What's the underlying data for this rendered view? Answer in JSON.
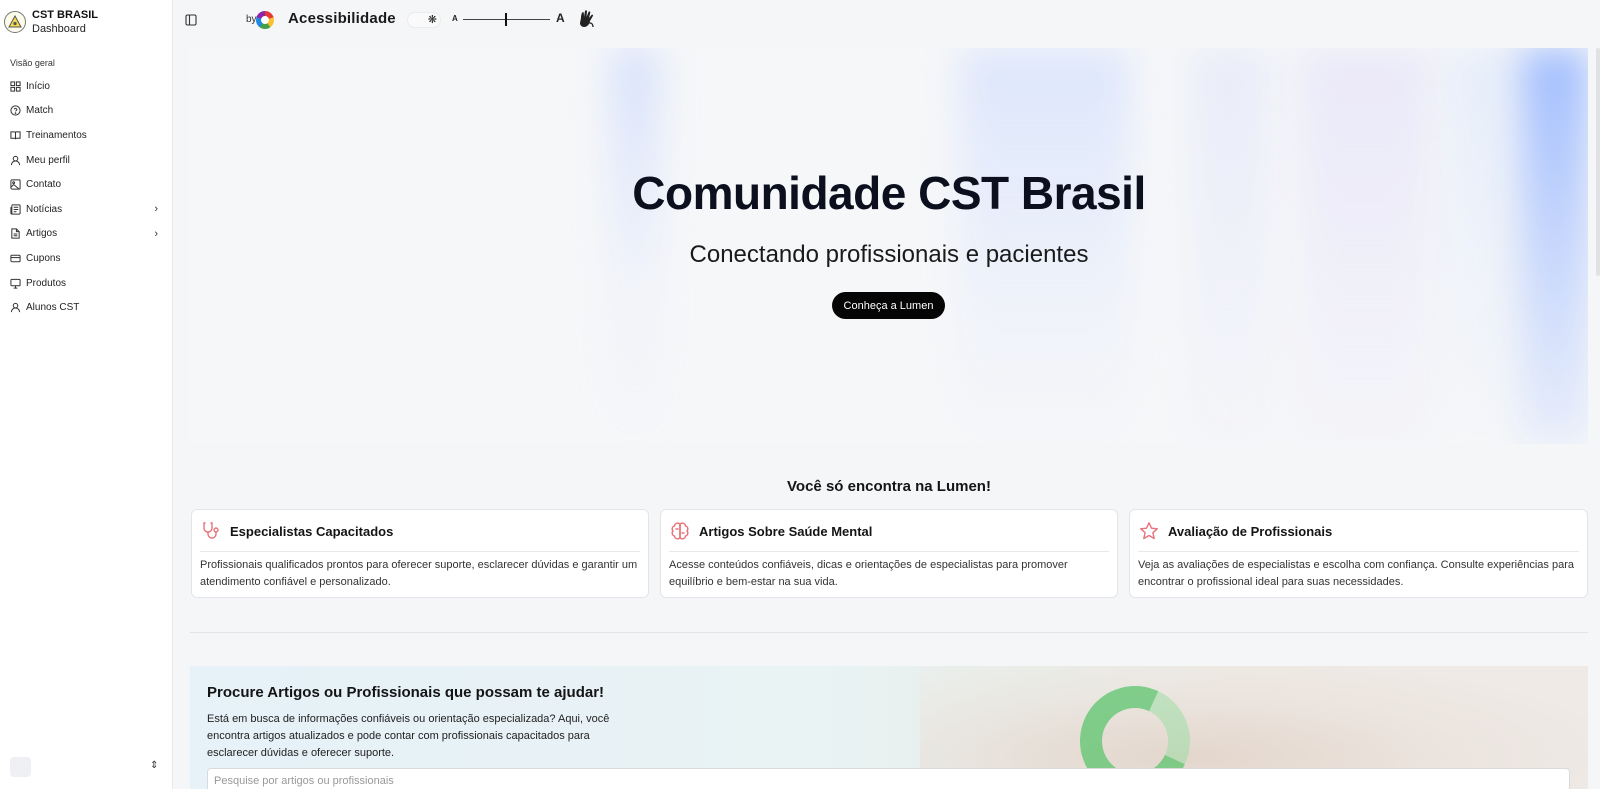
{
  "brand": {
    "name": "CST BRASIL",
    "subtitle": "Dashboard"
  },
  "sidebar": {
    "group_label": "Visão geral",
    "items": [
      {
        "label": "Início",
        "icon": "grid-icon"
      },
      {
        "label": "Match",
        "icon": "help-circle-icon"
      },
      {
        "label": "Treinamentos",
        "icon": "book-open-icon"
      },
      {
        "label": "Meu perfil",
        "icon": "user-icon"
      },
      {
        "label": "Contato",
        "icon": "image-icon"
      },
      {
        "label": "Notícias",
        "icon": "newspaper-icon",
        "has_submenu": true
      },
      {
        "label": "Artigos",
        "icon": "file-text-icon",
        "has_submenu": true
      },
      {
        "label": "Cupons",
        "icon": "credit-card-icon"
      },
      {
        "label": "Produtos",
        "icon": "monitor-icon"
      },
      {
        "label": "Alunos CST",
        "icon": "user-icon"
      }
    ],
    "chevron": "›",
    "switcher": "⇕"
  },
  "topbar": {
    "by_label": "by",
    "accessibility_title": "Acessibilidade",
    "font_small": "A",
    "font_large": "A",
    "font_scale_level": 0.48,
    "theme_icon": "❋"
  },
  "hero": {
    "title": "Comunidade CST Brasil",
    "subtitle": "Conectando profissionais e pacientes",
    "cta_label": "Conheça a Lumen"
  },
  "features": {
    "title": "Você só encontra na Lumen!",
    "accent_color": "#e8737a",
    "cards": [
      {
        "title": "Especialistas Capacitados",
        "icon": "stethoscope-icon",
        "text": "Profissionais qualificados prontos para oferecer suporte, esclarecer dúvidas e garantir um atendimento confiável e personalizado."
      },
      {
        "title": "Artigos Sobre Saúde Mental",
        "icon": "brain-icon",
        "text": "Acesse conteúdos confiáveis, dicas e orientações de especialistas para promover equilíbrio e bem-estar na sua vida."
      },
      {
        "title": "Avaliação de Profissionais",
        "icon": "star-icon",
        "text": "Veja as avaliações de especialistas e escolha com confiança. Consulte experiências para encontrar o profissional ideal para suas necessidades."
      }
    ]
  },
  "search": {
    "title": "Procure Artigos ou Profissionais que possam te ajudar!",
    "description": "Está em busca de informações confiáveis ou orientação especializada? Aqui, você encontra artigos atualizados e pode contar com profissionais capacitados para esclarecer dúvidas e oferecer suporte.",
    "placeholder": "Pesquise por artigos ou profissionais",
    "value": ""
  }
}
